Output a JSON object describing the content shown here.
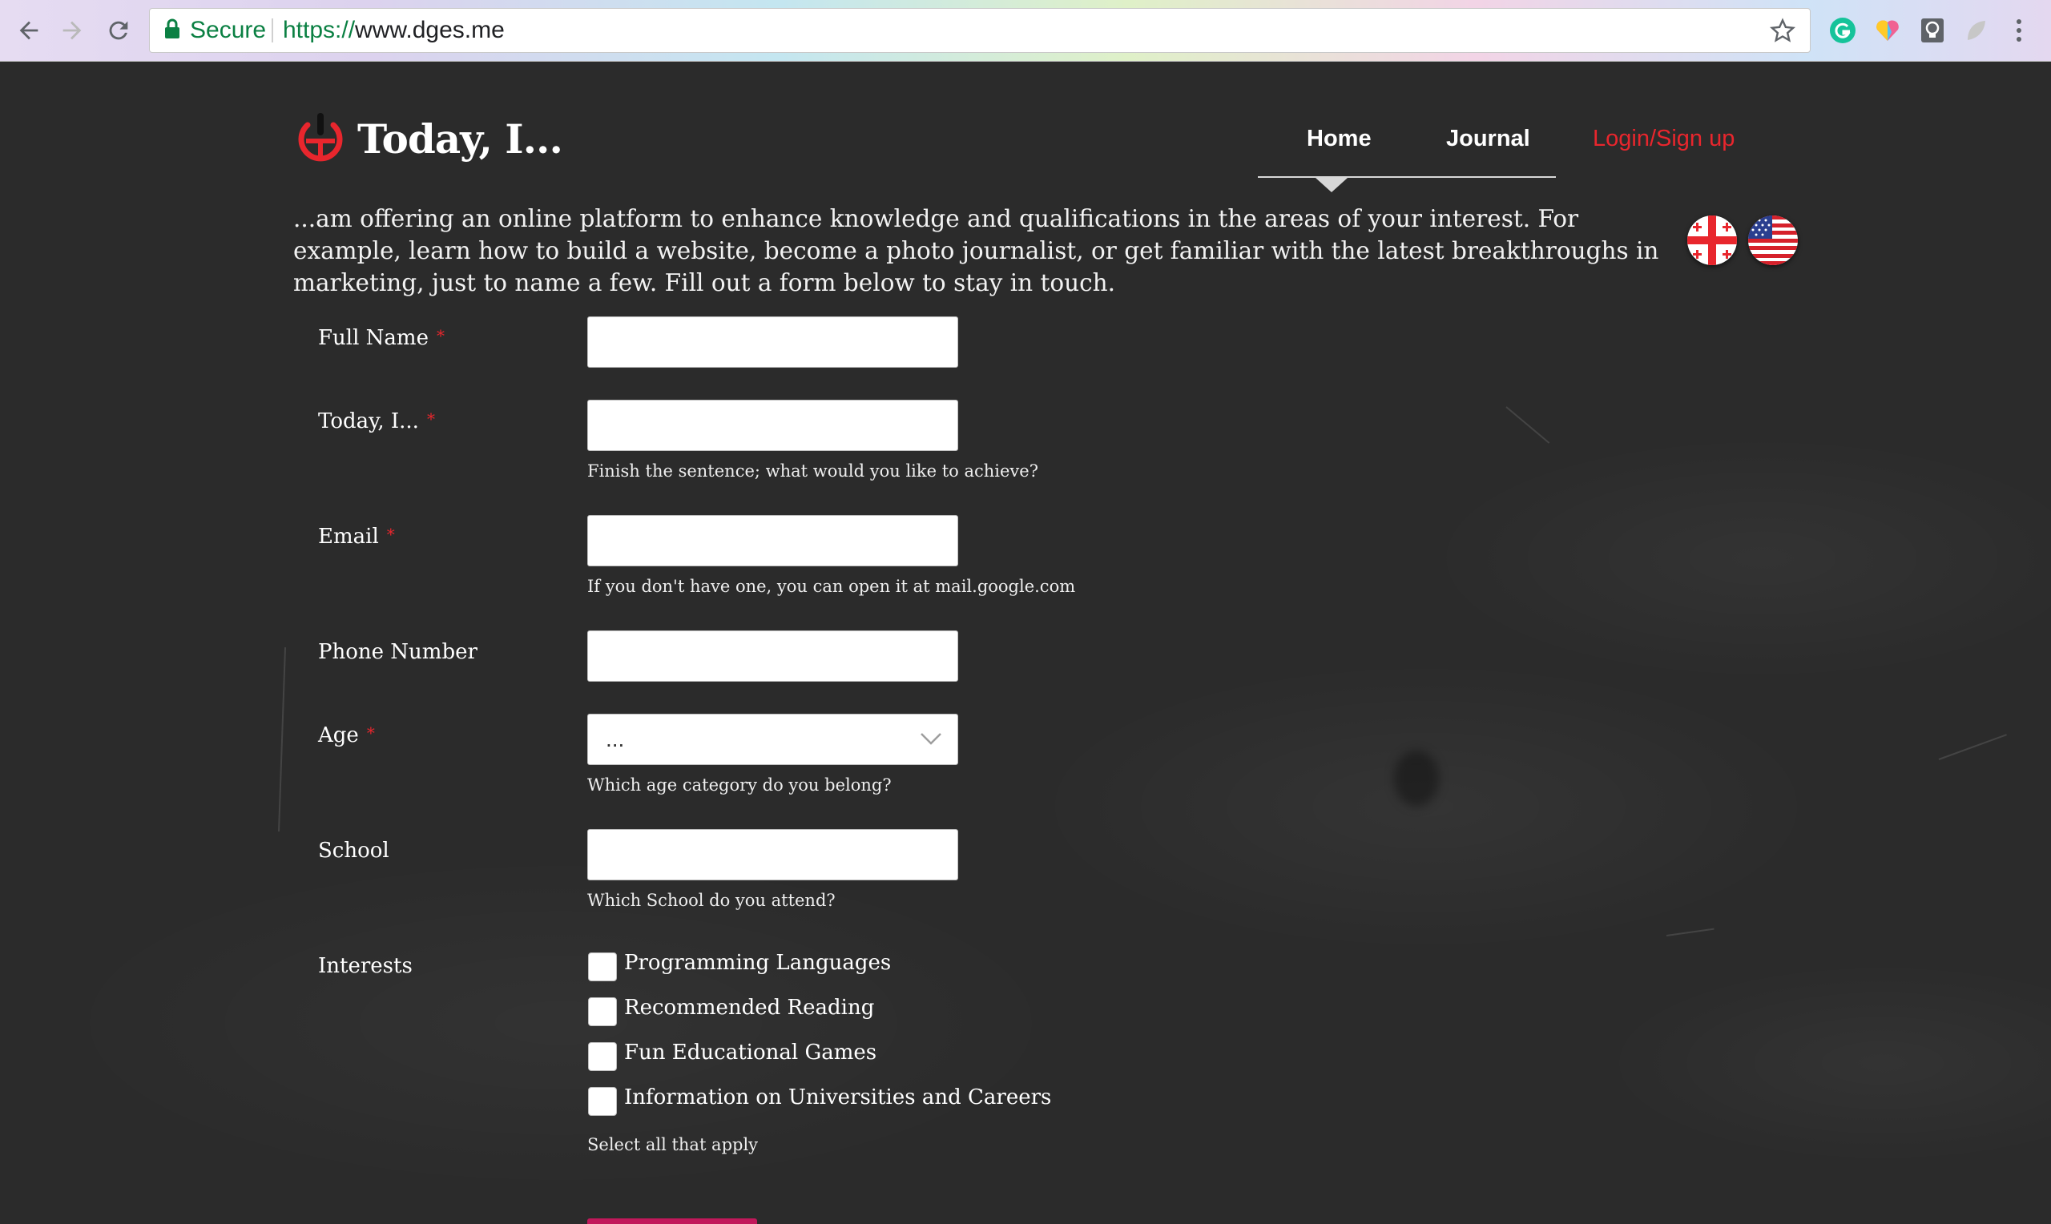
{
  "browser": {
    "secure_label": "Secure",
    "url_scheme": "https://",
    "url_host": "www.dges.me",
    "icons": [
      "back-arrow-icon",
      "forward-arrow-icon",
      "reload-icon",
      "lock-icon",
      "star-icon",
      "grammarly-icon",
      "heart-extension-icon",
      "lightbulb-extension-icon",
      "leaf-extension-icon",
      "more-menu-icon"
    ]
  },
  "header": {
    "logo_text": "Today, I...",
    "nav": {
      "home": "Home",
      "journal": "Journal",
      "login": "Login/Sign up"
    },
    "accent_color": "#e8262d"
  },
  "intro_text": "...am offering an online platform to enhance knowledge and qualifications in the areas of your interest. For example, learn how to build a website, become a photo journalist, or get familiar with the latest breakthroughs in marketing, just to name a few. Fill out a form below to stay in touch.",
  "languages": [
    "georgia-flag-icon",
    "usa-flag-icon"
  ],
  "form": {
    "required_mark": "*",
    "full_name": {
      "label": "Full Name",
      "value": ""
    },
    "today": {
      "label": "Today, I...",
      "value": "",
      "help": "Finish the sentence; what would you like to achieve?"
    },
    "email": {
      "label": "Email",
      "value": "",
      "help": "If you don't have one, you can open it at mail.google.com"
    },
    "phone": {
      "label": "Phone Number",
      "value": ""
    },
    "age": {
      "label": "Age",
      "selected": "...",
      "help": "Which age category do you belong?"
    },
    "school": {
      "label": "School",
      "value": "",
      "help": "Which School do you attend?"
    },
    "interests": {
      "label": "Interests",
      "options": [
        "Programming Languages",
        "Recommended Reading",
        "Fun Educational Games",
        "Information on Universities and Careers"
      ],
      "help": "Select all that apply"
    }
  }
}
